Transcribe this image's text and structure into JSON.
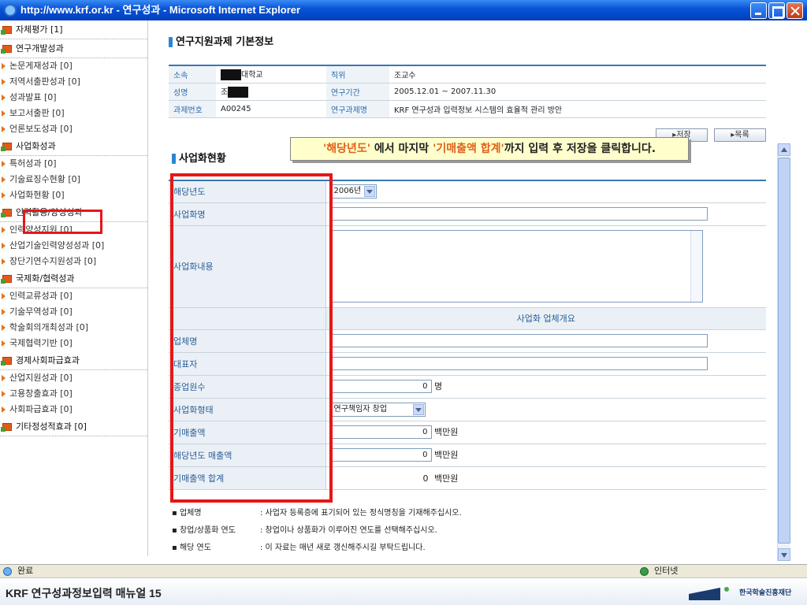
{
  "window": {
    "title": "http://www.krf.or.kr - 연구성과 - Microsoft Internet Explorer"
  },
  "sidebar": {
    "top_item": "자체평가 [1]",
    "groups": [
      {
        "label": "연구개발성과",
        "items": [
          "논문게재성과 [0]",
          "저역서출판성과 [0]",
          "성과발표 [0]",
          "보고서출판 [0]",
          "언론보도성과 [0]"
        ]
      },
      {
        "label": "사업화성과",
        "items": [
          "특허성과 [0]",
          "기술료징수현황 [0]",
          "사업화현황 [0]"
        ]
      },
      {
        "label": "인력활용/양성성과",
        "items": [
          "인력양성지원 [0]",
          "산업기술인력양성성과 [0]",
          "장단기연수지원성과 [0]"
        ]
      },
      {
        "label": "국제화/협력성과",
        "items": [
          "인력교류성과 [0]",
          "기술무역성과 [0]",
          "학술회의개최성과 [0]",
          "국제협력기반 [0]"
        ]
      },
      {
        "label": "경제사회파급효과",
        "items": [
          "산업지원성과 [0]",
          "고용창출효과 [0]",
          "사회파급효과 [0]"
        ]
      },
      {
        "label": "기타정성적효과 [0]",
        "items": []
      }
    ]
  },
  "basic": {
    "title": "연구지원과제 기본정보",
    "r1": {
      "l1": "소속",
      "v1": "대학교",
      "l2": "직위",
      "v2": "조교수"
    },
    "r2": {
      "l1": "성명",
      "v1": "조",
      "l2": "연구기간",
      "v2": "2005.12.01 ~ 2007.11.30"
    },
    "r3": {
      "l1": "과제번호",
      "v1": "A00245",
      "l2": "연구과제명",
      "v2": "KRF 연구성과 입력정보 시스템의 효율적 관리 방안"
    }
  },
  "buttons": {
    "save": "▸저장",
    "list": "▸목록"
  },
  "tooltip": {
    "a": "'해당년도'",
    "b": " 에서 마지막 ",
    "c": "'기매출액 합계'",
    "d": "까지 입력 후 저장을 클릭합니다."
  },
  "biz": {
    "title": "사업화현황",
    "year_label": "해당년도",
    "year_value": "2006년",
    "name_label": "사업화명",
    "content_label": "사업화내용",
    "company_header": "사업화 업체개요",
    "company_label": "업체명",
    "ceo_label": "대표자",
    "emp_label": "종업원수",
    "emp_value": "0",
    "emp_unit": "명",
    "type_label": "사업화형태",
    "type_value": "연구책임자 창업",
    "prev_label": "기매출액",
    "prev_value": "0",
    "prev_unit": "백만원",
    "cur_label": "해당년도 매출액",
    "cur_value": "0",
    "cur_unit": "백만원",
    "total_label": "기매출액 합계",
    "total_value": "0",
    "total_unit": "백만원"
  },
  "notes": [
    {
      "k": "▪ 업체명",
      "v": ": 사업자 등록증에 표기되어 있는 정식명칭을 기재해주십시오."
    },
    {
      "k": "▪ 창업/상품화 연도",
      "v": ": 창업이나 상품화가 이루어진 연도를 선택해주십시오."
    },
    {
      "k": "▪ 해당 연도",
      "v": ": 이 자료는 매년 새로 갱신해주시길 부탁드립니다."
    }
  ],
  "status": {
    "left": "완료",
    "zone": "인터넷"
  },
  "footer": {
    "caption": "KRF 연구성과정보입력 매뉴얼 15",
    "org": "한국학술진흥재단"
  }
}
